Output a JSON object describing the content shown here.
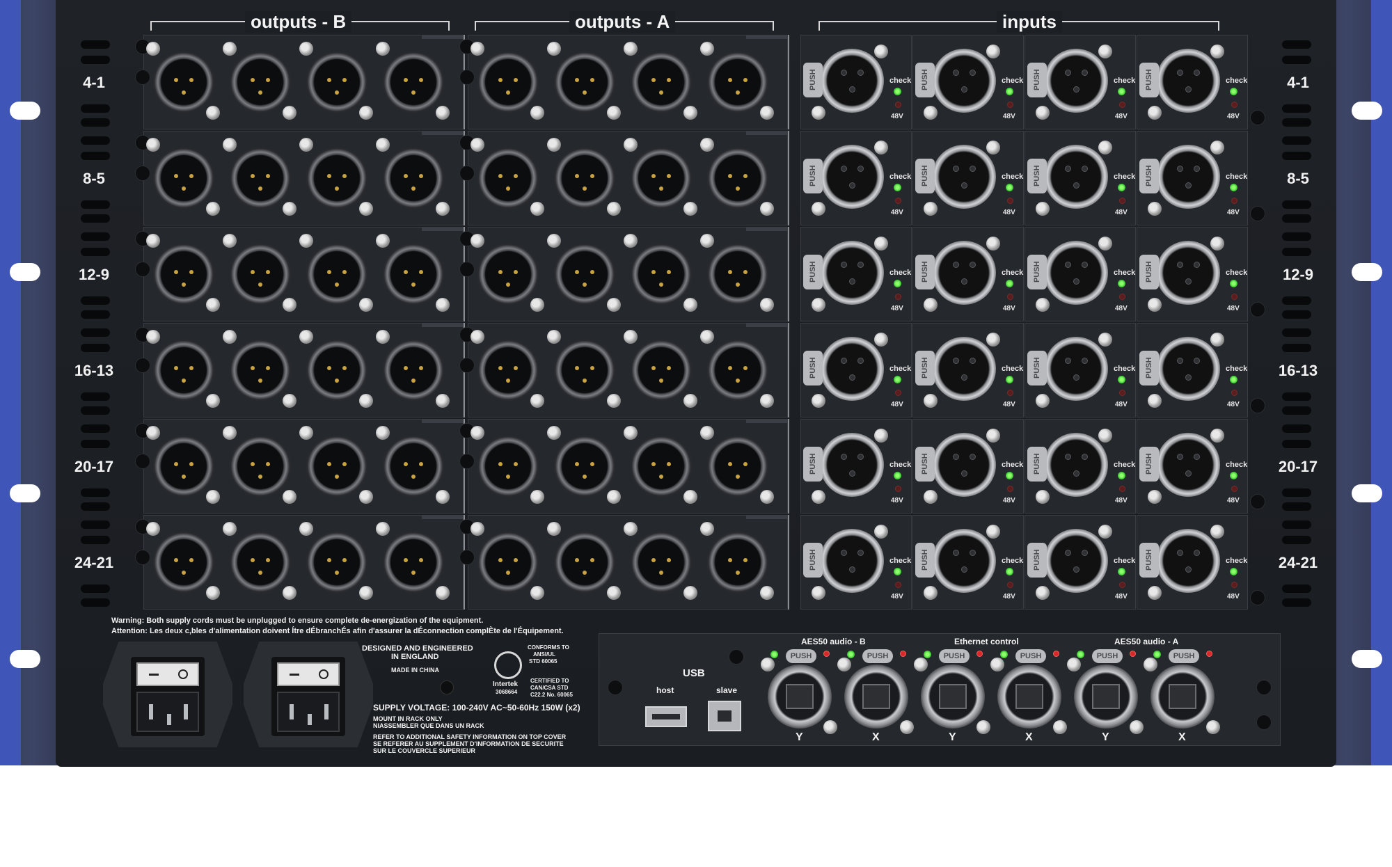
{
  "groups": {
    "outputs_b": "outputs - B",
    "outputs_a": "outputs - A",
    "inputs": "inputs"
  },
  "row_labels": [
    "4-1",
    "8-5",
    "12-9",
    "16-13",
    "20-17",
    "24-21"
  ],
  "input_card": {
    "push": "PUSH",
    "check": "check",
    "phantom": "48V"
  },
  "warnings": {
    "en": "Warning: Both supply cords must be unplugged to ensure complete de-energization of the equipment.",
    "fr": "Attention: Les deux c,bles d'alimentation doivent Ítre dÉbranchÉs afin d'assurer la dÉconnection complÈte de l'Équipement."
  },
  "info": {
    "designed": "DESIGNED AND ENGINEERED",
    "designed2": "IN ENGLAND",
    "made": "MADE IN CHINA",
    "conforms": "CONFORMS TO",
    "conforms2": "ANSI/UL",
    "conforms3": "STD 60065",
    "certified": "CERTIFIED TO",
    "certified2": "CAN/CSA STD",
    "certified3": "C22.2 No. 60065",
    "intertek": "Intertek",
    "intertek_no": "3068664",
    "supply": "SUPPLY VOLTAGE: 100-240V  AC~50-60Hz 150W (x2)",
    "mount1": "MOUNT IN RACK ONLY",
    "mount2": "NIASSEMBLER QUE DANS UN RACK",
    "refer1": "REFER TO ADDITIONAL SAFETY INFORMATION ON TOP COVER",
    "refer2": "SE REFERER AU SUPPLEMENT D'INFORMATION DE SECURITE",
    "refer3": "SUR LE COUVERCLE SUPERIEUR"
  },
  "usb": {
    "title": "USB",
    "host": "host",
    "slave": "slave"
  },
  "network": {
    "aes50_b": "AES50 audio - B",
    "ethernet": "Ethernet control",
    "aes50_a": "AES50 audio - A",
    "push": "PUSH",
    "ports": [
      "Y",
      "X",
      "Y",
      "X",
      "Y",
      "X"
    ]
  },
  "colors": {
    "chassis": "#1c1f23",
    "ear_blue": "#3f56b8",
    "led_green": "#3fd63a",
    "led_red": "#d62a2a",
    "pin_gold": "#c9a342"
  }
}
